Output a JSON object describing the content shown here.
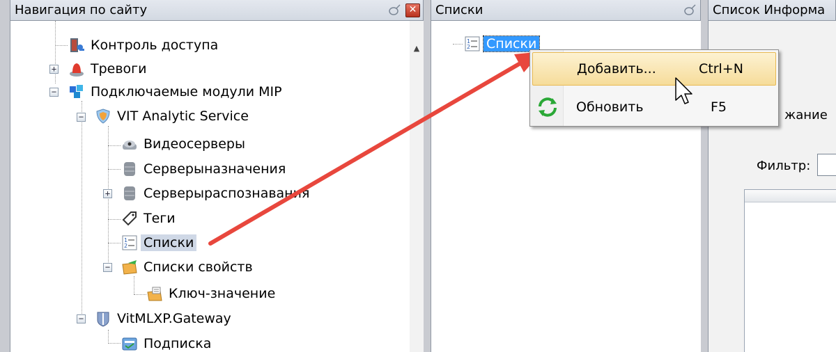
{
  "nav_pane": {
    "title": "Навигация по сайту",
    "close_glyph": "✕",
    "items": [
      {
        "label": "Контроль доступа",
        "icon": "access-control-icon"
      },
      {
        "label": "Тревоги",
        "icon": "alarm-icon"
      },
      {
        "label": "Подключаемые модули MIP",
        "icon": "plugin-icon"
      },
      {
        "label": "VIT Analytic Service",
        "icon": "shield-icon"
      },
      {
        "label": "Видеосерверы",
        "icon": "camera-icon"
      },
      {
        "label": "Серверыназначения",
        "icon": "server-icon"
      },
      {
        "label": "Серверыраспознавания",
        "icon": "server-icon"
      },
      {
        "label": "Теги",
        "icon": "tag-icon"
      },
      {
        "label": "Списки",
        "icon": "list-icon"
      },
      {
        "label": "Списки свойств",
        "icon": "property-list-icon"
      },
      {
        "label": "Ключ-значение",
        "icon": "key-value-icon"
      },
      {
        "label": "VitMLXP.Gateway",
        "icon": "gateway-icon"
      },
      {
        "label": "Подписка",
        "icon": "subscription-icon"
      }
    ]
  },
  "lists_pane": {
    "title": "Списки",
    "root_item": "Списки"
  },
  "info_pane": {
    "title": "Список Информа",
    "content_fragment": "жание",
    "filter_label": "Фильтр:"
  },
  "context_menu": {
    "items": [
      {
        "label": "Добавить...",
        "shortcut": "Ctrl+N",
        "icon": ""
      },
      {
        "label": "Обновить",
        "shortcut": "F5",
        "icon": "refresh-icon"
      }
    ]
  },
  "annotation": {
    "arrow_color": "#e8473d"
  }
}
